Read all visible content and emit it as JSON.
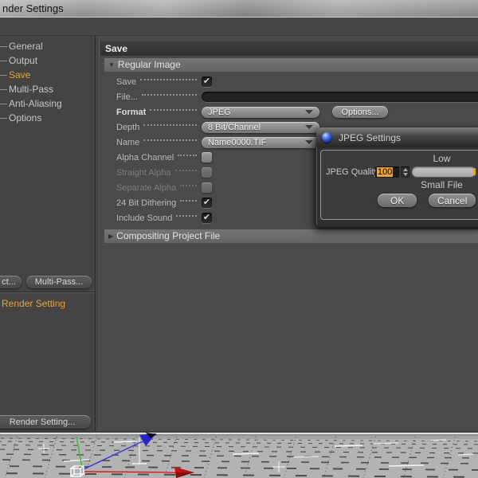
{
  "window": {
    "title": "nder Settings"
  },
  "sidebar": {
    "items": [
      {
        "label": "General"
      },
      {
        "label": "Output"
      },
      {
        "label": "Save"
      },
      {
        "label": "Multi-Pass"
      },
      {
        "label": "Anti-Aliasing"
      },
      {
        "label": "Options"
      }
    ],
    "effect_button": "ct...",
    "multipass_button": "Multi-Pass...",
    "preset_label": "Render Setting",
    "new_render_setting_button": "Render Setting..."
  },
  "panel": {
    "header": "Save",
    "regular_section": "Regular Image",
    "compositing_section": "Compositing Project File",
    "options_button": "Options...",
    "rows": {
      "save": "Save",
      "file": "File...",
      "format": "Format",
      "format_value": "JPEG",
      "depth": "Depth",
      "depth_value": "8 Bit/Channel",
      "name": "Name",
      "name_value": "Name0000.TIF",
      "alpha": "Alpha Channel",
      "straight": "Straight Alpha",
      "separate": "Separate Alpha",
      "dither": "24 Bit Dithering",
      "sound": "Include Sound"
    }
  },
  "dialog": {
    "title": "JPEG Settings",
    "quality_label": "JPEG Quality",
    "quality_value": "100",
    "scale_top": "Low",
    "scale_bottom": "Small File",
    "ok_button": "OK",
    "cancel_button": "Cancel"
  },
  "icons": {
    "check": "✔",
    "section_expanded": "▼",
    "section_collapsed": "▶"
  },
  "colors": {
    "accent_orange": "#e8a33c",
    "panel_gray": "#4a4a4a",
    "viewport_ground": "#b3b3b3"
  }
}
